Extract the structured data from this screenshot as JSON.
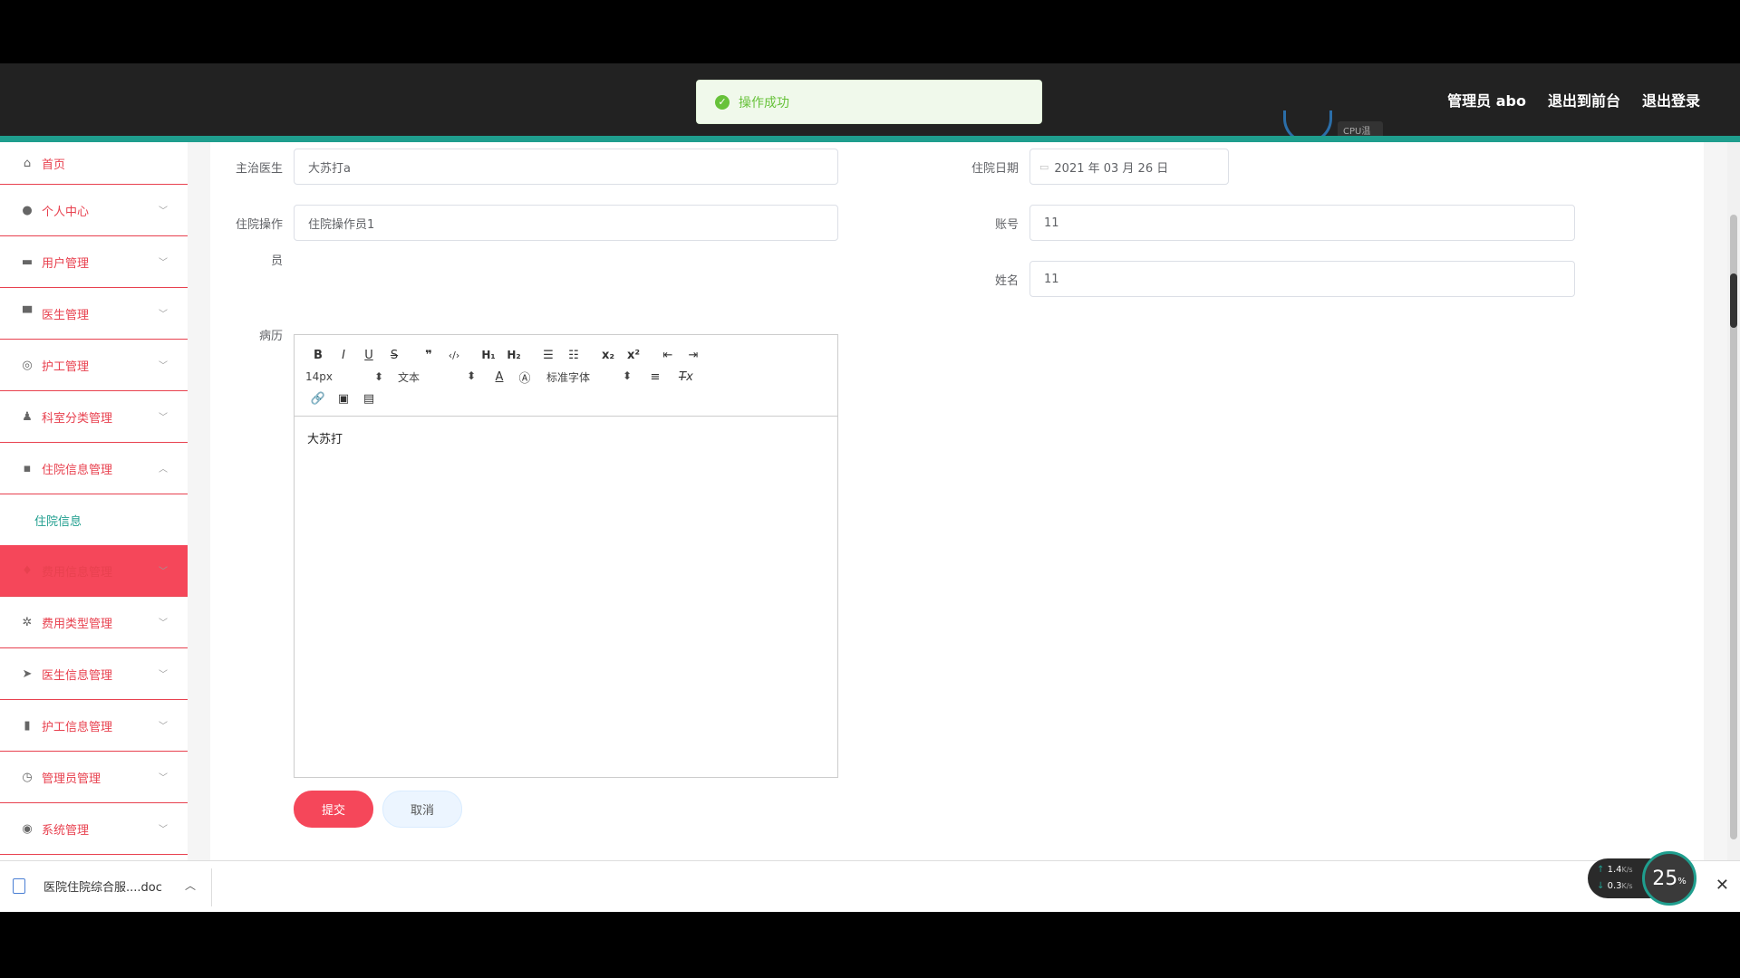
{
  "header": {
    "admin_label": "管理员 abo",
    "front_link": "退出到前台",
    "logout_link": "退出登录",
    "cpu_label": "CPU温度"
  },
  "toast": {
    "message": "操作成功",
    "icon": "check-circle-icon"
  },
  "sidebar": {
    "items": [
      {
        "label": "首页",
        "icon": "home-icon"
      },
      {
        "label": "个人中心",
        "icon": "user-icon"
      },
      {
        "label": "用户管理",
        "icon": "ticket-icon"
      },
      {
        "label": "医生管理",
        "icon": "monitor-icon"
      },
      {
        "label": "护工管理",
        "icon": "dashboard-icon"
      },
      {
        "label": "科室分类管理",
        "icon": "person-icon"
      },
      {
        "label": "住院信息管理",
        "icon": "chat-icon"
      },
      {
        "label": "住院信息",
        "icon": ""
      },
      {
        "label": "费用信息管理",
        "icon": "microphone-icon"
      },
      {
        "label": "费用类型管理",
        "icon": "aperture-icon"
      },
      {
        "label": "医生信息管理",
        "icon": "send-icon"
      },
      {
        "label": "护工信息管理",
        "icon": "bar-chart-icon"
      },
      {
        "label": "管理员管理",
        "icon": "clock-icon"
      },
      {
        "label": "系统管理",
        "icon": "settings-icon"
      }
    ]
  },
  "form": {
    "doctor_label": "主治医生",
    "doctor_value": "大苏打a",
    "date_label": "住院日期",
    "date_value": "2021 年 03 月 26 日",
    "operator_label_1": "住院操作",
    "operator_label_2": "员",
    "operator_value": "住院操作员1",
    "account_label": "账号",
    "account_value": "11",
    "name_label": "姓名",
    "name_value": "11",
    "record_label": "病历",
    "editor_content": "大苏打",
    "submit_label": "提交",
    "cancel_label": "取消"
  },
  "editor_toolbar": {
    "font_size": "14px",
    "text_style": "文本",
    "font_family": "标准字体"
  },
  "download": {
    "filename": "医院住院综合服....doc"
  },
  "netmon": {
    "up": "1.4",
    "down": "0.3",
    "unit": "K/s",
    "percent": "25",
    "percent_unit": "%"
  }
}
